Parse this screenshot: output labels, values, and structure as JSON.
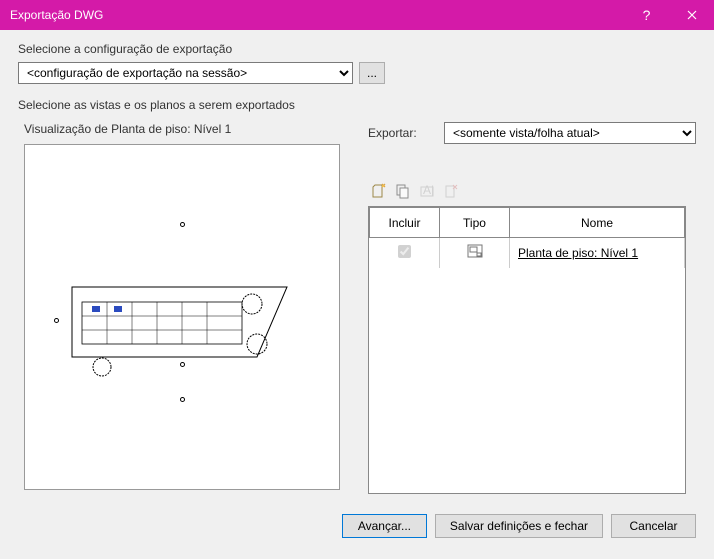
{
  "titlebar": {
    "title": "Exportação DWG"
  },
  "config": {
    "label": "Selecione a configuração de exportação",
    "selected": "<configuração de exportação na sessão>",
    "dots": "..."
  },
  "views": {
    "label": "Selecione as vistas e os planos a serem exportados",
    "preview_title": "Visualização de Planta de piso: Nível 1",
    "export_label": "Exportar:",
    "export_selected": "<somente vista/folha atual>"
  },
  "grid": {
    "headers": {
      "include": "Incluir",
      "type": "Tipo",
      "name": "Nome"
    },
    "rows": [
      {
        "included": true,
        "type_icon": "sheet-icon",
        "name": "Planta de piso: Nível 1"
      }
    ]
  },
  "footer": {
    "next": "Avançar...",
    "save": "Salvar definições e fechar",
    "cancel": "Cancelar"
  }
}
